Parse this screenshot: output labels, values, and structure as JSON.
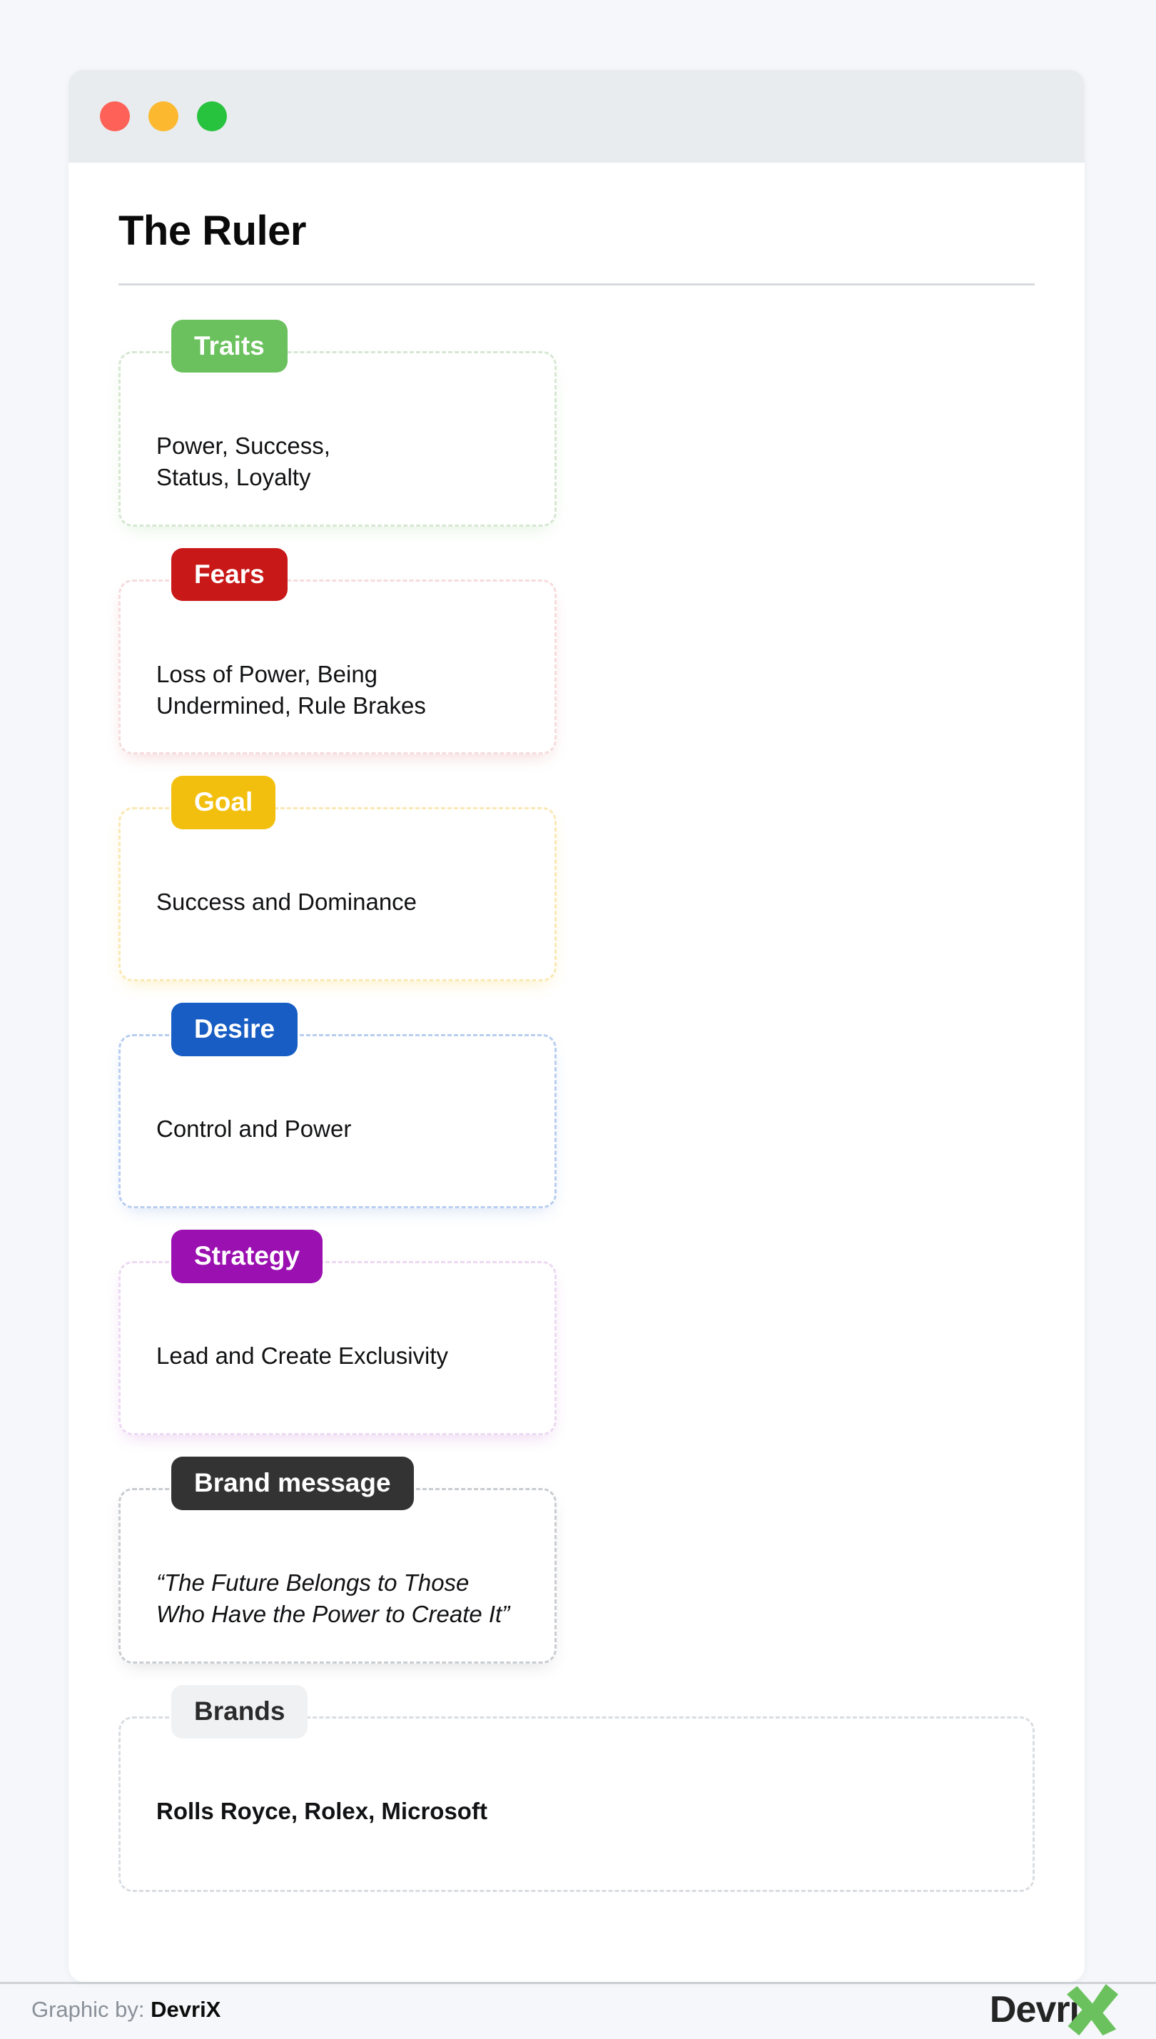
{
  "window": {
    "controls": [
      {
        "name": "close",
        "color": "#fd6157"
      },
      {
        "name": "minimize",
        "color": "#fcb82e"
      },
      {
        "name": "maximize",
        "color": "#27c23e"
      }
    ]
  },
  "archetype": {
    "title": "The Ruler"
  },
  "cards": [
    {
      "key": "traits",
      "badge": "Traits",
      "badge_color": "#6ac15d",
      "text": "Power, Success,\nStatus, Loyalty",
      "style": "normal"
    },
    {
      "key": "fears",
      "badge": "Fears",
      "badge_color": "#c81818",
      "text": "Loss of Power, Being\nUndermined, Rule Brakes",
      "style": "normal"
    },
    {
      "key": "goal",
      "badge": "Goal",
      "badge_color": "#f2bf0e",
      "text": "Success and Dominance",
      "style": "normal"
    },
    {
      "key": "desire",
      "badge": "Desire",
      "badge_color": "#175dc3",
      "text": "Control and Power",
      "style": "normal"
    },
    {
      "key": "strategy",
      "badge": "Strategy",
      "badge_color": "#9a10b0",
      "text": "Lead and Create Exclusivity",
      "style": "normal"
    },
    {
      "key": "brand-message",
      "badge": "Brand message",
      "badge_color": "#333333",
      "text": "“The Future Belongs to Those\nWho Have the Power to Create It”",
      "style": "italic"
    },
    {
      "key": "brands",
      "badge": "Brands",
      "badge_color": "#f0f1f3",
      "text": "Rolls Royce, Rolex, Microsoft",
      "style": "bold"
    }
  ],
  "footer": {
    "credit_label": "Graphic by:",
    "credit_brand": "DevriX",
    "logo_text": "Devri",
    "logo_mark": "x-mark-icon",
    "logo_mark_color": "#6ac15d"
  }
}
